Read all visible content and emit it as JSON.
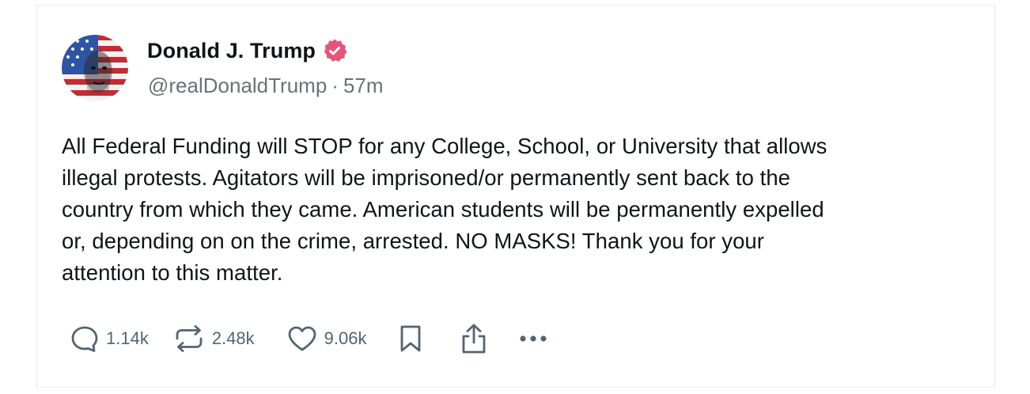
{
  "post": {
    "author": {
      "display_name": "Donald J. Trump",
      "handle": "@realDonaldTrump",
      "separator": "·",
      "time_ago": "57m",
      "verified": true
    },
    "text_lines": [
      "All Federal Funding will STOP for any College, School, or University that allows",
      "illegal protests. Agitators will be imprisoned/or permanently sent back to the",
      "country from which they came. American students will be permanently expelled",
      "or, depending on on the crime, arrested. NO MASKS! Thank you for your",
      "attention to this matter."
    ],
    "actions": {
      "reply": {
        "icon": "reply-icon",
        "count": "1.14k"
      },
      "retruth": {
        "icon": "retruth-icon",
        "count": "2.48k"
      },
      "like": {
        "icon": "heart-icon",
        "count": "9.06k"
      },
      "bookmark": {
        "icon": "bookmark-icon"
      },
      "share": {
        "icon": "share-icon"
      },
      "more": {
        "icon": "more-icon"
      }
    }
  },
  "colors": {
    "verified_badge": "#e8537a",
    "muted_text": "#6b7178",
    "icon_stroke": "#536471",
    "primary_text": "#0f1419"
  }
}
